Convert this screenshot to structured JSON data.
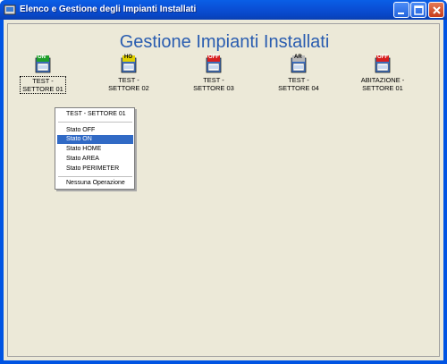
{
  "window": {
    "title": "Elenco e Gestione degli Impianti Installati"
  },
  "page": {
    "title": "Gestione Impianti Installati"
  },
  "devices": [
    {
      "line1": "TEST -",
      "line2": "SETTORE 01",
      "badge": "ON",
      "badge_color": "#1f9e2a",
      "badge_text_color": "#ffffff"
    },
    {
      "line1": "TEST -",
      "line2": "SETTORE 02",
      "badge": "HO",
      "badge_color": "#e0d000",
      "badge_text_color": "#000000"
    },
    {
      "line1": "TEST -",
      "line2": "SETTORE 03",
      "badge": "OFF",
      "badge_color": "#d61f1f",
      "badge_text_color": "#ffffff"
    },
    {
      "line1": "TEST -",
      "line2": "SETTORE 04",
      "badge": "AR",
      "badge_color": "#b8b8b8",
      "badge_text_color": "#000000"
    },
    {
      "line1": "ABITAZIONE -",
      "line2": "SETTORE 01",
      "badge": "OFF",
      "badge_color": "#d61f1f",
      "badge_text_color": "#ffffff"
    }
  ],
  "context_menu": {
    "header": "TEST - SETTORE 01",
    "items": [
      "Stato OFF",
      "Stato ON",
      "Stato HOME",
      "Stato AREA",
      "Stato PERIMETER"
    ],
    "active_item": "Stato ON",
    "footer": "Nessuna Operazione"
  },
  "colors": {
    "titlebar": "#0a4fd6",
    "accent_title": "#2a5db0",
    "menu_highlight": "#316ac5"
  }
}
